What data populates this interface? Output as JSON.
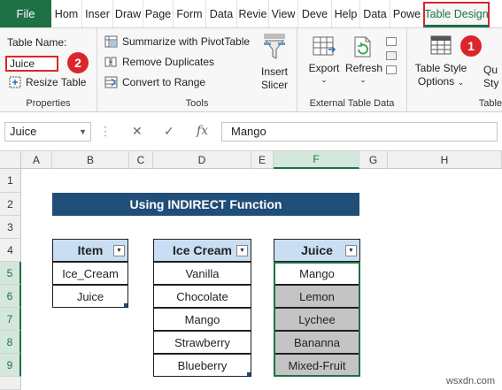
{
  "tabs": [
    {
      "label": "File"
    },
    {
      "label": "Hom"
    },
    {
      "label": "Inser"
    },
    {
      "label": "Draw"
    },
    {
      "label": "Page"
    },
    {
      "label": "Form"
    },
    {
      "label": "Data"
    },
    {
      "label": "Revie"
    },
    {
      "label": "View"
    },
    {
      "label": "Deve"
    },
    {
      "label": "Help"
    },
    {
      "label": "Data"
    },
    {
      "label": "Powe"
    },
    {
      "label": "Table Design"
    }
  ],
  "ribbon": {
    "properties": {
      "table_name_label": "Table Name:",
      "table_name_value": "Juice",
      "resize_label": "Resize Table",
      "group_label": "Properties"
    },
    "tools": {
      "pivot_label": "Summarize with PivotTable",
      "dupes_label": "Remove Duplicates",
      "range_label": "Convert to Range",
      "slicer_line1": "Insert",
      "slicer_line2": "Slicer",
      "group_label": "Tools"
    },
    "external": {
      "export_label": "Export",
      "refresh_label": "Refresh",
      "group_label": "External Table Data"
    },
    "style_options": {
      "line1": "Table Style",
      "line2": "Options",
      "quick_line1": "Qu",
      "quick_line2": "Sty",
      "group_label": "Table"
    },
    "badge1": "1",
    "badge2": "2"
  },
  "formula_bar": {
    "name_box": "Juice",
    "cancel": "✕",
    "enter": "✓",
    "fx": "fx",
    "value": "Mango"
  },
  "columns": [
    "A",
    "B",
    "C",
    "D",
    "E",
    "F",
    "G",
    "H"
  ],
  "rows": [
    "1",
    "2",
    "3",
    "4",
    "5",
    "6",
    "7",
    "8",
    "9"
  ],
  "sheet": {
    "title": "Using INDIRECT Function",
    "item_table": {
      "header": "Item",
      "values": [
        "Ice_Cream",
        "Juice"
      ]
    },
    "icecream_table": {
      "header": "Ice Cream",
      "values": [
        "Vanilla",
        "Chocolate",
        "Mango",
        "Strawberry",
        "Blueberry"
      ]
    },
    "juice_table": {
      "header": "Juice",
      "values": [
        "Mango",
        "Lemon",
        "Lychee",
        "Bananna",
        "Mixed-Fruit"
      ]
    }
  },
  "watermark": "wsxdn.com"
}
